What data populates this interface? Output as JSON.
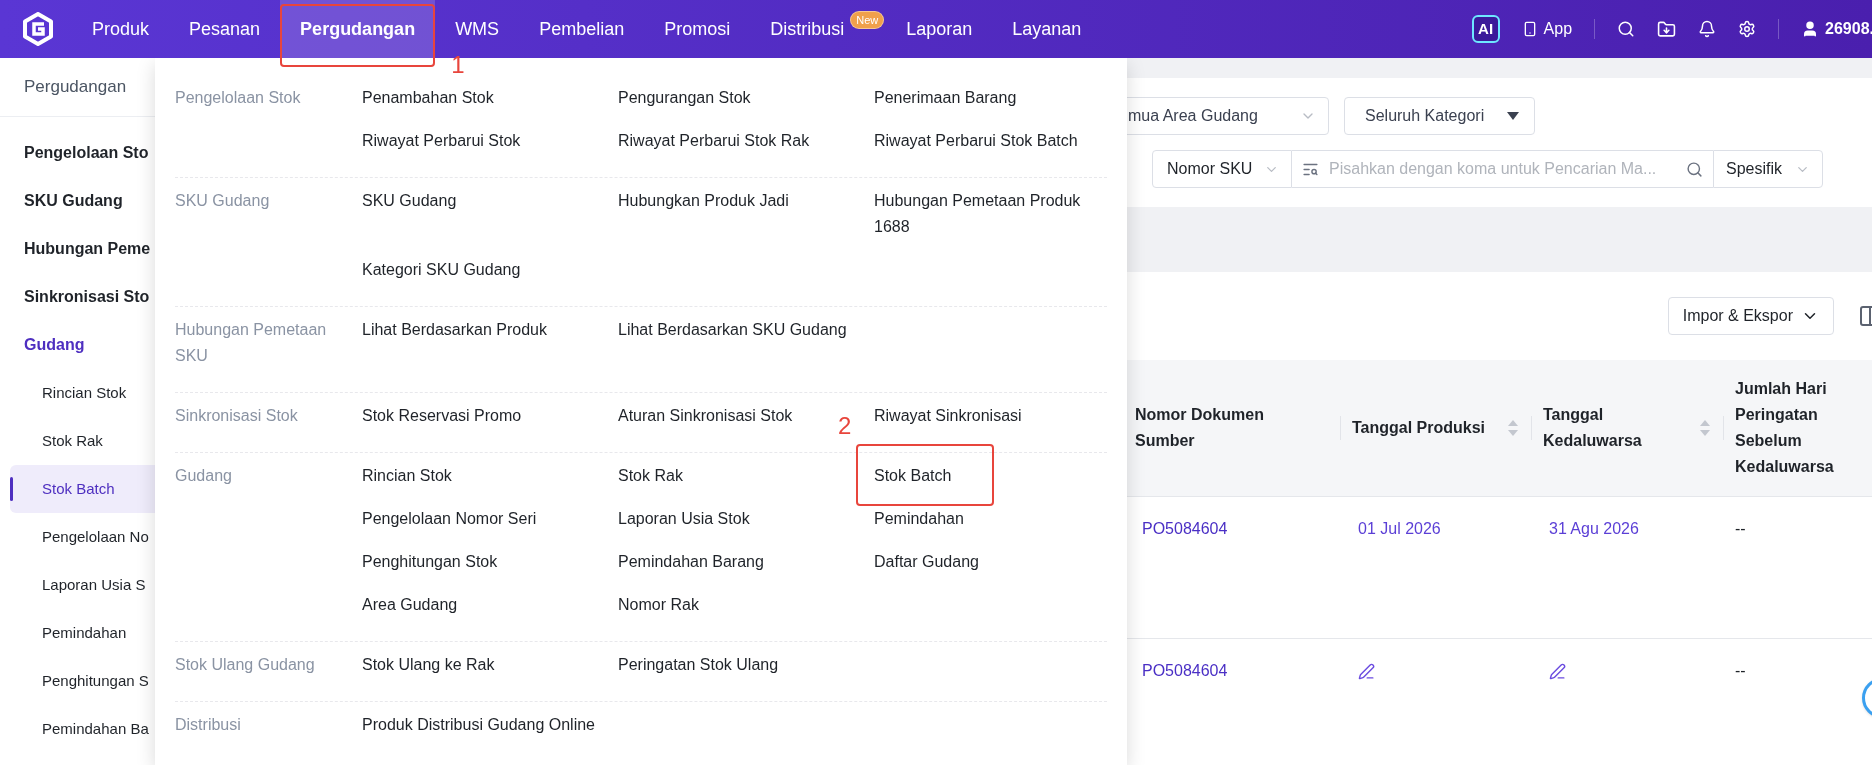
{
  "nav": {
    "items": [
      {
        "label": "Produk",
        "selected": false
      },
      {
        "label": "Pesanan",
        "selected": false
      },
      {
        "label": "Pergudangan",
        "selected": true,
        "annotation": "1"
      },
      {
        "label": "WMS",
        "selected": false
      },
      {
        "label": "Pembelian",
        "selected": false
      },
      {
        "label": "Promosi",
        "selected": false
      },
      {
        "label": "Distribusi",
        "selected": false,
        "badge": "New"
      },
      {
        "label": "Laporan",
        "selected": false
      },
      {
        "label": "Layanan",
        "selected": false
      }
    ]
  },
  "header_actions": {
    "ai": "AI",
    "app": "App",
    "user": "26908."
  },
  "sidebar": {
    "title": "Pergudangan",
    "items": [
      {
        "label": "Pengelolaan Sto",
        "expanded": false
      },
      {
        "label": "SKU Gudang",
        "expanded": false
      },
      {
        "label": "Hubungan Peme",
        "expanded": false
      },
      {
        "label": "Sinkronisasi Sto",
        "expanded": false
      },
      {
        "label": "Gudang",
        "expanded": true,
        "children": [
          {
            "label": "Rincian Stok",
            "selected": false
          },
          {
            "label": "Stok Rak",
            "selected": false
          },
          {
            "label": "Stok Batch",
            "selected": true
          },
          {
            "label": "Pengelolaan No",
            "selected": false
          },
          {
            "label": "Laporan Usia S",
            "selected": false
          },
          {
            "label": "Pemindahan",
            "selected": false
          },
          {
            "label": "Penghitungan S",
            "selected": false
          },
          {
            "label": "Pemindahan Ba",
            "selected": false
          }
        ]
      }
    ]
  },
  "menu": {
    "sections": [
      {
        "label": "Pengelolaan Stok",
        "items": [
          {
            "label": "Penambahan Stok"
          },
          {
            "label": "Pengurangan Stok"
          },
          {
            "label": "Penerimaan Barang"
          },
          {
            "label": "Riwayat Perbarui Stok"
          },
          {
            "label": "Riwayat Perbarui Stok Rak"
          },
          {
            "label": "Riwayat Perbarui Stok Batch"
          }
        ]
      },
      {
        "label": "SKU Gudang",
        "items": [
          {
            "label": "SKU Gudang"
          },
          {
            "label": "Hubungkan Produk Jadi"
          },
          {
            "label": "Hubungan Pemetaan Produk 1688"
          },
          {
            "label": "Kategori SKU Gudang"
          }
        ]
      },
      {
        "label": "Hubungan Pemetaan SKU",
        "items": [
          {
            "label": "Lihat Berdasarkan Produk"
          },
          {
            "label": "Lihat Berdasarkan SKU Gudang"
          }
        ]
      },
      {
        "label": "Sinkronisasi Stok",
        "items": [
          {
            "label": "Stok Reservasi Promo"
          },
          {
            "label": "Aturan Sinkronisasi Stok"
          },
          {
            "label": "Riwayat Sinkronisasi"
          }
        ]
      },
      {
        "label": "Gudang",
        "items": [
          {
            "label": "Rincian Stok"
          },
          {
            "label": "Stok Rak"
          },
          {
            "label": "Stok Batch",
            "annotation": "2"
          },
          {
            "label": "Pengelolaan Nomor Seri"
          },
          {
            "label": "Laporan Usia Stok"
          },
          {
            "label": "Pemindahan"
          },
          {
            "label": "Penghitungan Stok"
          },
          {
            "label": "Pemindahan Barang"
          },
          {
            "label": "Daftar Gudang"
          },
          {
            "label": "Area Gudang"
          },
          {
            "label": "Nomor Rak"
          }
        ]
      },
      {
        "label": "Stok Ulang Gudang",
        "items": [
          {
            "label": "Stok Ulang ke Rak"
          },
          {
            "label": "Peringatan Stok Ulang"
          }
        ]
      },
      {
        "label": "Distribusi",
        "items": [
          {
            "label": "Produk Distribusi Gudang Online"
          }
        ]
      }
    ]
  },
  "filters": {
    "area": "mua Area Gudang",
    "category": "Seluruh Kategori",
    "search_field": "Nomor SKU",
    "search_placeholder": "Pisahkan dengan koma untuk Pencarian Ma...",
    "match": "Spesifik"
  },
  "toolbar": {
    "import_export": "Impor & Ekspor"
  },
  "table": {
    "columns": [
      {
        "label": "Nomor Dokumen Sumber",
        "sortable": false
      },
      {
        "label": "Tanggal Produksi",
        "sortable": true
      },
      {
        "label": "Tanggal Kedaluwarsa",
        "sortable": true
      },
      {
        "label": "Jumlah Hari Peringatan Sebelum Kedaluwarsa",
        "sortable": false
      }
    ],
    "rows": [
      {
        "cells": [
          {
            "kind": "link",
            "text": "PO5084604"
          },
          {
            "kind": "date",
            "text": "01 Jul 2026"
          },
          {
            "kind": "date",
            "text": "31 Agu 2026"
          },
          {
            "kind": "text",
            "text": "--"
          }
        ]
      },
      {
        "cells": [
          {
            "kind": "link",
            "text": "PO5084604"
          },
          {
            "kind": "edit"
          },
          {
            "kind": "edit"
          },
          {
            "kind": "text",
            "text": "--"
          }
        ]
      }
    ]
  }
}
